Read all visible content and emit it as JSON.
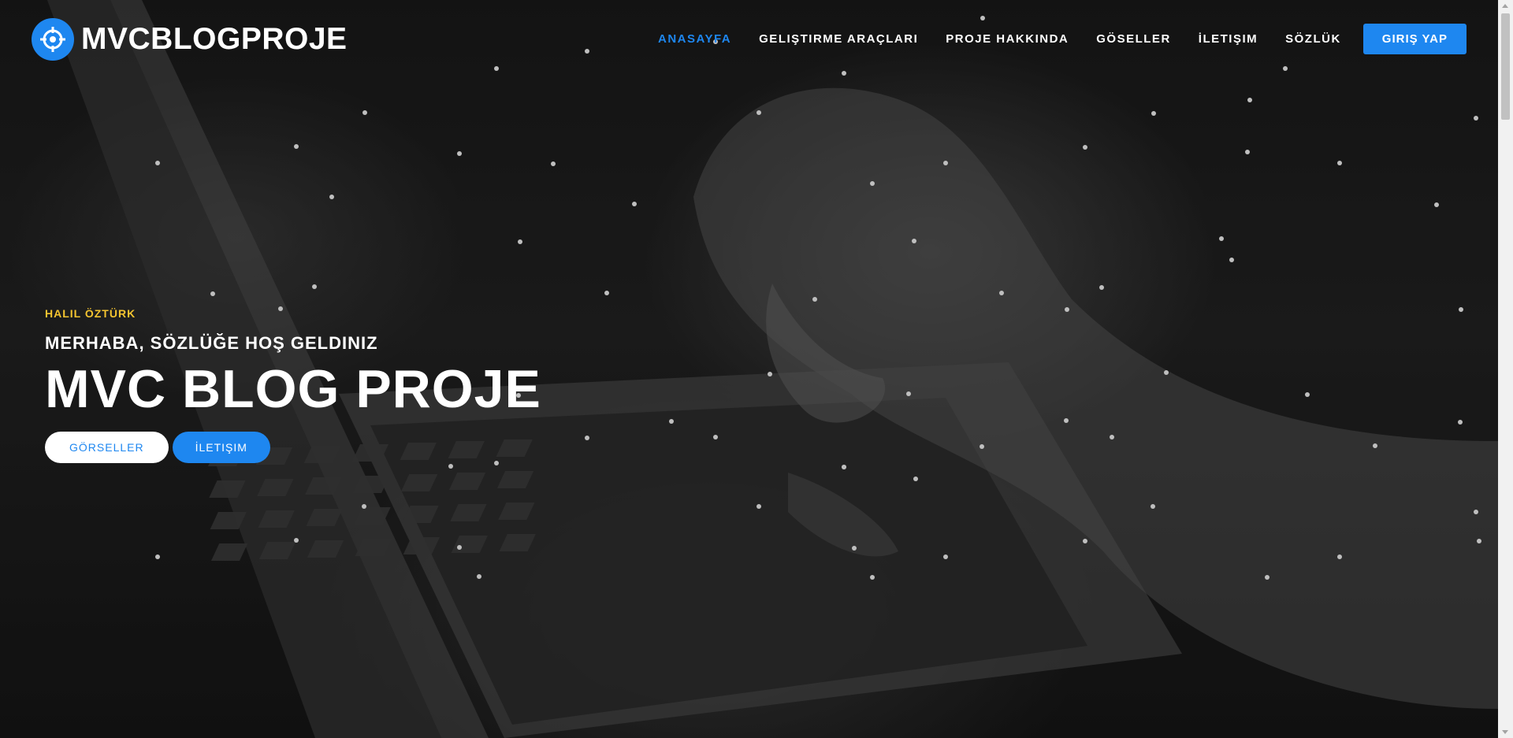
{
  "brand": {
    "name": "MVCBLOGPROJE",
    "icon": "crosshair-icon"
  },
  "nav": {
    "items": [
      {
        "label": "ANASAYFA",
        "active": true
      },
      {
        "label": "GELIŞTIRME ARAÇLARI",
        "active": false
      },
      {
        "label": "PROJE HAKKINDA",
        "active": false
      },
      {
        "label": "GÖSELLER",
        "active": false
      },
      {
        "label": "İLETIŞIM",
        "active": false
      },
      {
        "label": "SÖZLÜK",
        "active": false
      }
    ],
    "login_label": "GIRIŞ YAP"
  },
  "hero": {
    "eyebrow": "HALIL ÖZTÜRK",
    "subtitle": "MERHABA, SÖZLÜĞE HOŞ GELDINIZ",
    "headline": "MVC BLOG PROJE",
    "buttons": {
      "gallery_label": "GÖRSELLER",
      "contact_label": "İLETIŞIM"
    }
  },
  "colors": {
    "accent": "#1e87f0",
    "eyebrow": "#f4c430",
    "text": "#ffffff"
  }
}
